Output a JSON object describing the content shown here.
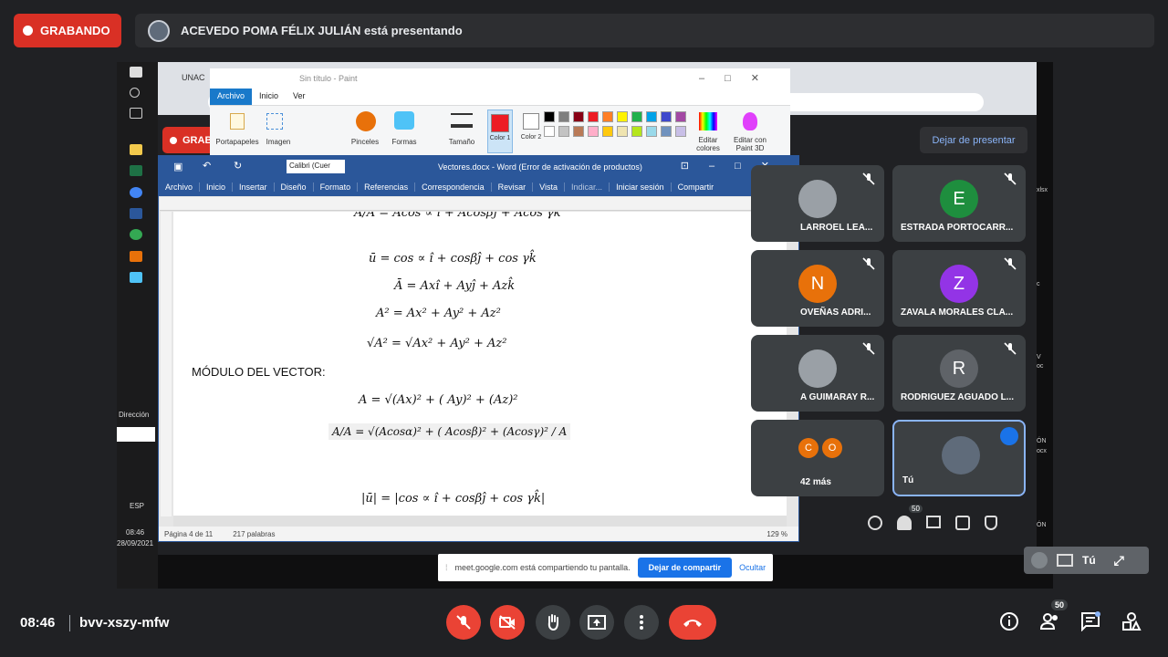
{
  "meet": {
    "recording_label": "GRABANDO",
    "presenting_text": "ACEVEDO POMA FÉLIX JULIÁN está presentando",
    "meeting_time": "08:46",
    "meeting_code": "bvv-xszy-mfw",
    "people_count": "50",
    "self_label": "Tú"
  },
  "shared_screen": {
    "chrome_tab": "UNAC",
    "inner_recording_label": "GRAB",
    "inner_stop_presenting": "Dejar de presentar",
    "inner_people_count": "50",
    "windows_taskbar": {
      "direction_label": "Dirección",
      "lang": "ESP",
      "time": "08:46",
      "date": "28/09/2021"
    },
    "share_popup": {
      "text": "meet.google.com está compartiendo tu pantalla.",
      "stop_button": "Dejar de compartir",
      "hide_button": "Ocultar"
    },
    "side_snips": [
      "xlsx",
      "c",
      "V",
      "oc",
      "ÓN",
      "ocx",
      "ÓN"
    ]
  },
  "paint": {
    "title": "Sin título - Paint",
    "tabs": [
      "Archivo",
      "Inicio",
      "Ver"
    ],
    "groups": [
      "Portapapeles",
      "Imagen",
      "Pinceles",
      "Formas",
      "Tamaño",
      "Color 1",
      "Color 2",
      "Editar colores",
      "Editar con Paint 3D"
    ],
    "colors": [
      "#000000",
      "#7f7f7f",
      "#880015",
      "#ed1c24",
      "#ff7f27",
      "#fff200",
      "#22b14c",
      "#00a2e8",
      "#3f48cc",
      "#a349a4",
      "#ffffff",
      "#c3c3c3",
      "#b97a57",
      "#ffaec9",
      "#ffc90e",
      "#efe4b0",
      "#b5e61d",
      "#99d9ea",
      "#7092be",
      "#c8bfe7"
    ]
  },
  "word": {
    "title": "Vectores.docx - Word (Error de activación de productos)",
    "font_box": "Calibri (Cuer",
    "menu": [
      "Archivo",
      "Inicio",
      "Insertar",
      "Diseño",
      "Formato",
      "Referencias",
      "Correspondencia",
      "Revisar",
      "Vista",
      "Indicar...",
      "Iniciar sesión",
      "Compartir"
    ],
    "equations": [
      "Ā/A = Acos ∝ î + Acosβĵ + Acos γk̂",
      "ū = cos ∝ î + cosβĵ + cos γk̂",
      "Ā = Axî + Ayĵ + Azk̂",
      "A² = Ax²  +  Ay²   +  Az²",
      "√A² = √Ax²  +  Ay²   +  Az²",
      "A = √(Ax)²  + ( Ay)²   +  (Az)²",
      "A/A = √(Acosα)²  + ( Acosβ)²   +  (Acosγ)² / A",
      "|ū| = |cos ∝ î + cosβĵ + cos γk̂|"
    ],
    "section_heading": "MÓDULO DEL VECTOR:",
    "status": {
      "page": "Página 4 de 11",
      "words": "217 palabras",
      "zoom": "129 %"
    }
  },
  "participants": [
    {
      "name": "LARROEL LEA...",
      "initial": "",
      "color": "#9aa0a6"
    },
    {
      "name": "ESTRADA PORTOCARR...",
      "initial": "E",
      "color": "#1e8e3e"
    },
    {
      "name": "OVEÑAS ADRI...",
      "initial": "N",
      "color": "#e8710a"
    },
    {
      "name": "ZAVALA MORALES CLA...",
      "initial": "Z",
      "color": "#9334e6"
    },
    {
      "name": "A GUIMARAY R...",
      "initial": "",
      "color": "#9aa0a6"
    },
    {
      "name": "RODRIGUEZ AGUADO L...",
      "initial": "R",
      "color": "#5f6368"
    },
    {
      "name": "42 más",
      "initial": "",
      "color": "#e8710a"
    },
    {
      "name": "Tú",
      "initial": "",
      "color": "#5f6b7a"
    }
  ],
  "colors": {
    "recording_red": "#d93025",
    "hangup_red": "#ea4335",
    "meet_bg": "#202124",
    "word_blue": "#2b579a",
    "self_border": "#8ab4f8"
  }
}
